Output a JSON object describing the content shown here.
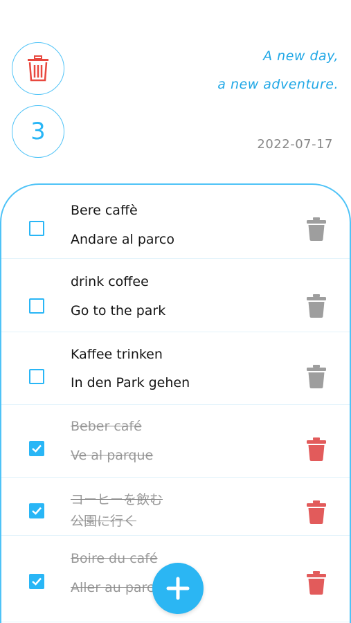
{
  "header": {
    "count": "3",
    "motto_line1": "A new day,",
    "motto_line2": "a new adventure.",
    "date": "2022-07-17"
  },
  "colors": {
    "accent": "#29b6f6",
    "delete_active": "#e25b5b",
    "delete_inactive": "#9e9e9e",
    "done_text": "#9a9a9a"
  },
  "todos": [
    {
      "line1": "Bere caffè",
      "line2": "Andare al parco",
      "done": false,
      "delete_icon": "trash-icon"
    },
    {
      "line1": "drink coffee",
      "line2": "Go to the park",
      "done": false,
      "delete_icon": "trash-icon"
    },
    {
      "line1": "Kaffee trinken",
      "line2": "In den Park gehen",
      "done": false,
      "delete_icon": "trash-icon"
    },
    {
      "line1": "Beber café",
      "line2": "Ve al parque",
      "done": true,
      "delete_icon": "trash-icon"
    },
    {
      "line1": "コーヒーを飲む",
      "line2": "公園に行く",
      "done": true,
      "delete_icon": "trash-icon"
    },
    {
      "line1": "Boire du café",
      "line2": "Aller au parc",
      "done": true,
      "delete_icon": "trash-icon"
    }
  ],
  "fab": {
    "icon": "plus-icon"
  }
}
